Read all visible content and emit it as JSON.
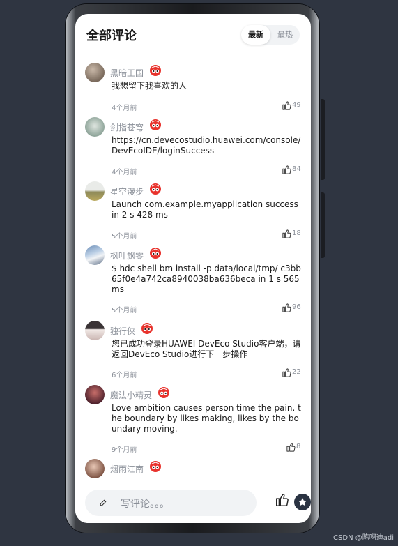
{
  "header": {
    "title": "全部评论",
    "sort_tabs": [
      {
        "label": "最新",
        "active": true
      },
      {
        "label": "最热",
        "active": false
      }
    ]
  },
  "comments": [
    {
      "user": "黑暗王国",
      "text": "我想留下我喜欢的人",
      "time": "4个月前",
      "likes": "49"
    },
    {
      "user": "剑指苍穹",
      "text": "https://cn.devecostudio.huawei.com/console/DevEcoIDE/loginSuccess",
      "time": "4个月前",
      "likes": "84"
    },
    {
      "user": "星空漫步",
      "text": "Launch com.example.myapplication success in 2 s 428 ms",
      "time": "5个月前",
      "likes": "18"
    },
    {
      "user": "枫叶飘零",
      "text": "$ hdc shell bm install -p data/local/tmp/ c3bb65f0e4a742ca8940038ba636beca  in 1 s 565 ms",
      "time": "5个月前",
      "likes": "96"
    },
    {
      "user": "独行侠",
      "text": "您已成功登录HUAWEI DevEco Studio客户端，请返回DevEco Studio进行下一步操作",
      "time": "6个月前",
      "likes": "22"
    },
    {
      "user": "魔法小精灵",
      "text": "Love ambition causes person time the pain. the boundary by likes making, likes by the boundary moving.",
      "time": "9个月前",
      "likes": "8"
    },
    {
      "user": "烟雨江南",
      "text": "",
      "time": "",
      "likes": ""
    }
  ],
  "footer": {
    "input_placeholder": "写评论。。。"
  },
  "watermark": "CSDN @陈啊迪adi",
  "colors": {
    "badge": "#e8322c",
    "muted": "#8a8f98",
    "star_button": "#2a3342"
  }
}
